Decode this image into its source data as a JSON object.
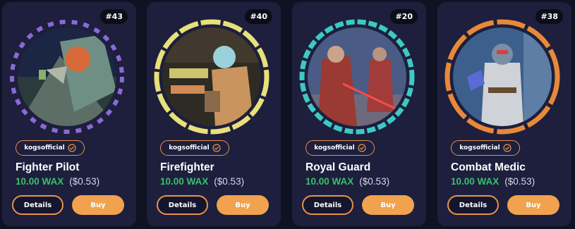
{
  "cards": [
    {
      "badge": "#43",
      "collection": "kogsofficial",
      "name": "Fighter Pilot",
      "price_wax": "10.00 WAX",
      "price_usd": "($0.53)",
      "details_label": "Details",
      "buy_label": "Buy",
      "ring_color": "#8a6ad6",
      "ring_style": "dashed"
    },
    {
      "badge": "#40",
      "collection": "kogsofficial",
      "name": "Firefighter",
      "price_wax": "10.00 WAX",
      "price_usd": "($0.53)",
      "details_label": "Details",
      "buy_label": "Buy",
      "ring_color": "#e8e07a",
      "ring_style": "segmented"
    },
    {
      "badge": "#20",
      "collection": "kogsofficial",
      "name": "Royal Guard",
      "price_wax": "10.00 WAX",
      "price_usd": "($0.53)",
      "details_label": "Details",
      "buy_label": "Buy",
      "ring_color": "#3ccac4",
      "ring_style": "segmented"
    },
    {
      "badge": "#38",
      "collection": "kogsofficial",
      "name": "Combat Medic",
      "price_wax": "10.00 WAX",
      "price_usd": "($0.53)",
      "details_label": "Details",
      "buy_label": "Buy",
      "ring_color": "#e8893a",
      "ring_style": "segmented"
    }
  ],
  "colors": {
    "background": "#0f1222",
    "card": "#1d1f3d",
    "accent": "#f0a24e",
    "wax_price": "#39c06a"
  }
}
